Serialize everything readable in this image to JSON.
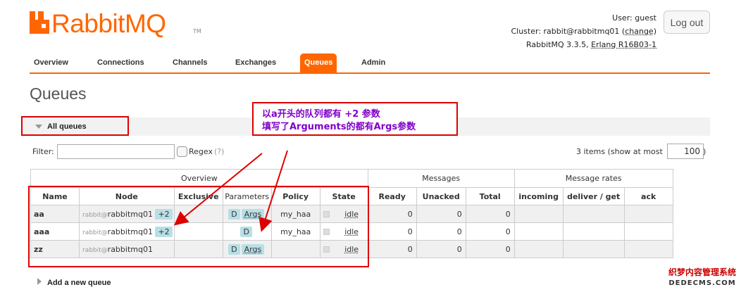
{
  "header": {
    "logo_text": "RabbitMQ",
    "logo_tm": "TM",
    "user_label": "User:",
    "user_value": "guest",
    "cluster_label": "Cluster:",
    "cluster_value": "rabbit@rabbitmq01",
    "cluster_change": "change",
    "version_text": "RabbitMQ 3.3.5,",
    "erlang_text": "Erlang R16B03-1",
    "logout_label": "Log out"
  },
  "nav": {
    "items": [
      "Overview",
      "Connections",
      "Channels",
      "Exchanges",
      "Queues",
      "Admin"
    ],
    "active": "Queues"
  },
  "page": {
    "title": "Queues",
    "section": "All queues",
    "filter_label": "Filter:",
    "filter_value": "",
    "regex_label": "Regex",
    "regex_help": "(?)",
    "items_text": "3 items (show at most",
    "items_value": "100",
    "items_close": ")",
    "add_queue": "Add a new queue"
  },
  "table": {
    "groups": [
      "Overview",
      "Messages",
      "Message rates"
    ],
    "columns": [
      "Name",
      "Node",
      "Exclusive",
      "Parameters",
      "Policy",
      "State",
      "Ready",
      "Unacked",
      "Total",
      "incoming",
      "deliver / get",
      "ack"
    ],
    "rows": [
      {
        "name": "aa",
        "node_prefix": "rabbit@",
        "node": "rabbitmq01",
        "node_extra": "+2",
        "params": [
          "D",
          "Args"
        ],
        "policy": "my_haa",
        "state": "idle",
        "ready": "0",
        "unacked": "0",
        "total": "0"
      },
      {
        "name": "aaa",
        "node_prefix": "rabbit@",
        "node": "rabbitmq01",
        "node_extra": "+2",
        "params": [
          "D"
        ],
        "policy": "my_haa",
        "state": "idle",
        "ready": "0",
        "unacked": "0",
        "total": "0"
      },
      {
        "name": "zz",
        "node_prefix": "rabbit@",
        "node": "rabbitmq01",
        "node_extra": "",
        "params": [
          "D",
          "Args"
        ],
        "policy": "",
        "state": "idle",
        "ready": "0",
        "unacked": "0",
        "total": "0"
      }
    ]
  },
  "annotation": {
    "line1": "以a开头的队列都有 +2 参数",
    "line2": "填写了Arguments的都有Args参数"
  },
  "watermark": {
    "line1": "织梦内容管理系统",
    "line2": "DEDECMS.COM"
  },
  "colors": {
    "brand": "#ff6600",
    "annotation_text": "#8000c8",
    "annotation_border": "#dd0000",
    "tag_bg": "#b8dfe6"
  }
}
